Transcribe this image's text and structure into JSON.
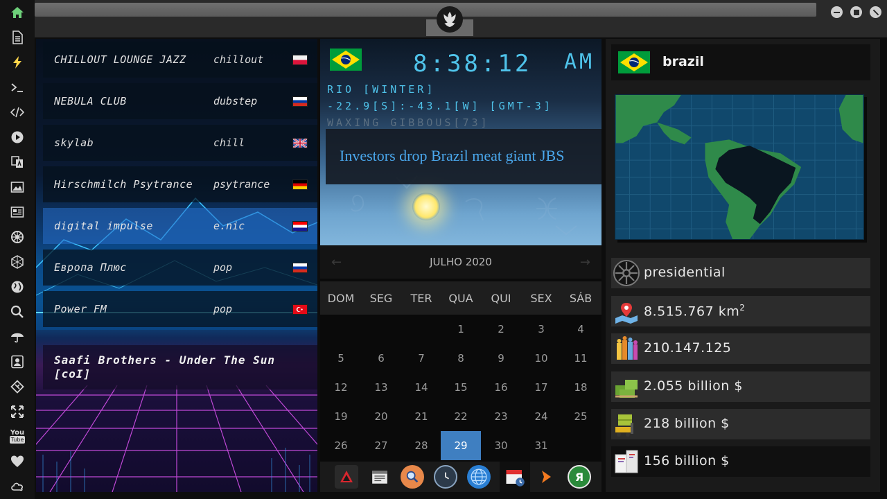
{
  "sidebar": {
    "icons": [
      "home-icon",
      "document-icon",
      "lightning-icon",
      "terminal-icon",
      "code-icon",
      "play-icon",
      "translate-icon",
      "image-icon",
      "news-icon",
      "empire-icon",
      "hexagon-icon",
      "globe-icon",
      "search-icon",
      "umbrella-icon",
      "contact-icon",
      "git-icon",
      "expand-icon",
      "youtube-icon",
      "heart-icon",
      "cloud-icon"
    ],
    "youtube_text": "You"
  },
  "radio": {
    "stations": [
      {
        "name": "CHILLOUT LOUNGE JAZZ",
        "genre": "chillout",
        "flag": "poland"
      },
      {
        "name": "NEBULA CLUB",
        "genre": "dubstep",
        "flag": "russia"
      },
      {
        "name": "skylab",
        "genre": "chill",
        "flag": "uk"
      },
      {
        "name": "Hirschmilch Psytrance",
        "genre": "psytrance",
        "flag": "germany"
      },
      {
        "name": "digital impulse",
        "genre": "e.nic",
        "flag": "croatia"
      },
      {
        "name": "Европа Плюс",
        "genre": "pop",
        "flag": "russia"
      },
      {
        "name": "Power FM",
        "genre": "pop",
        "flag": "turkey"
      }
    ],
    "now_playing_line1": "Saafi Brothers - Under The Sun",
    "now_playing_line2": "[coI]"
  },
  "clock": {
    "time": "8:38:12",
    "ampm": "AM",
    "location": "RIO [WINTER]",
    "coords": "-22.9[S]:-43.1[W] [GMT-3]",
    "moon": "WAXING GIBBOUS[73]",
    "headline": "Investors drop Brazil meat giant JBS"
  },
  "calendar": {
    "month_label": "JULHO 2020",
    "prev": "←",
    "next": "→",
    "weekdays": [
      "DOM",
      "SEG",
      "TER",
      "QUA",
      "QUI",
      "SEX",
      "SÁB"
    ],
    "days": [
      "1",
      "2",
      "3",
      "4",
      "5",
      "6",
      "7",
      "8",
      "9",
      "10",
      "11",
      "12",
      "13",
      "14",
      "15",
      "16",
      "17",
      "18",
      "19",
      "20",
      "21",
      "22",
      "23",
      "24",
      "25",
      "26",
      "27",
      "28",
      "29",
      "30",
      "31"
    ],
    "today": "29"
  },
  "dock": {
    "icons": [
      "ark-icon",
      "calendar-news-icon",
      "magnifier-icon",
      "clock-icon",
      "globe-icon",
      "calendar-clock-icon",
      "arrow-icon",
      "yandex-icon"
    ],
    "yandex_glyph": "Я"
  },
  "country": {
    "name": "brazil",
    "government": "presidential",
    "area": "8.515.767 km",
    "area_sup": "2",
    "population": "210.147.125",
    "gdp": "2.055 billion $",
    "exports": "218 billion $",
    "imports": "156 billion $"
  },
  "colors": {
    "accent_clock": "#4fc3ea",
    "headline": "#4aa7ec",
    "calendar_today": "#3f7fc1",
    "rail_active": "#6ed07a"
  }
}
